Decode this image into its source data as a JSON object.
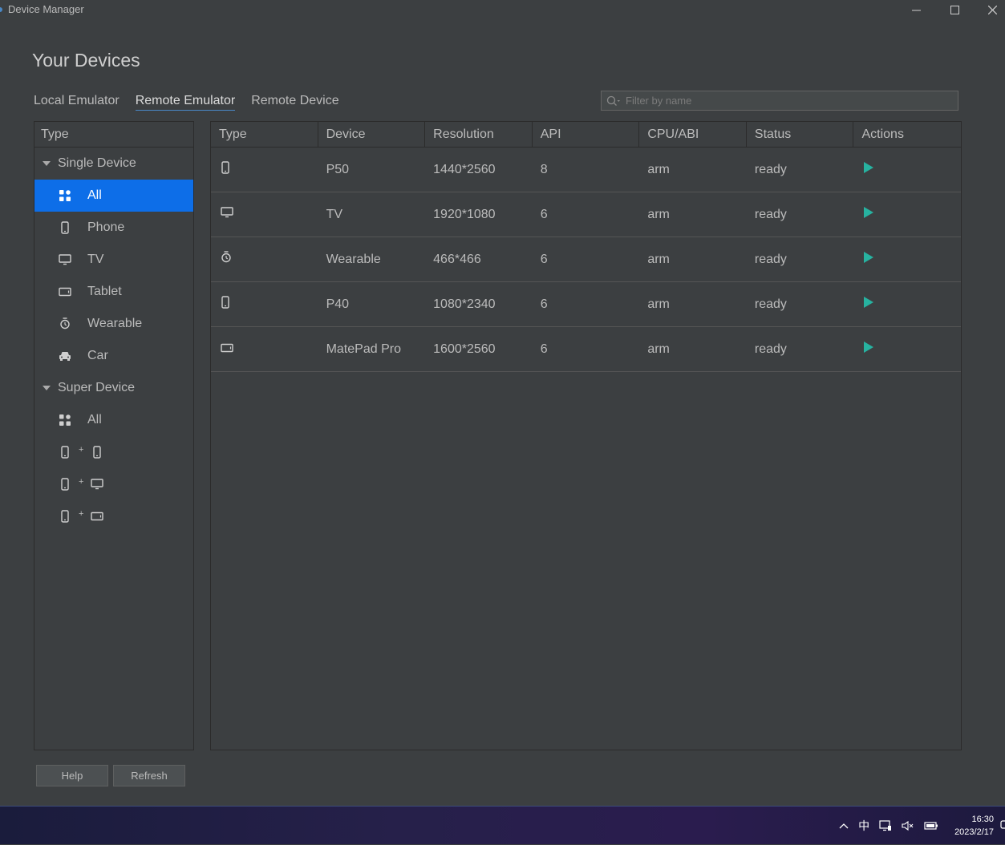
{
  "window": {
    "title": "Device Manager"
  },
  "page_title": "Your Devices",
  "tabs": [
    {
      "label": "Local Emulator",
      "active": false
    },
    {
      "label": "Remote Emulator",
      "active": true
    },
    {
      "label": "Remote Device",
      "active": false
    }
  ],
  "search": {
    "placeholder": "Filter by name",
    "value": ""
  },
  "sidebar": {
    "header": "Type",
    "groups": [
      {
        "label": "Single Device",
        "items": [
          {
            "label": "All",
            "icon": "grid-icon",
            "selected": true
          },
          {
            "label": "Phone",
            "icon": "phone-icon",
            "selected": false
          },
          {
            "label": "TV",
            "icon": "tv-icon",
            "selected": false
          },
          {
            "label": "Tablet",
            "icon": "tablet-icon",
            "selected": false
          },
          {
            "label": "Wearable",
            "icon": "watch-icon",
            "selected": false
          },
          {
            "label": "Car",
            "icon": "car-icon",
            "selected": false
          }
        ]
      },
      {
        "label": "Super Device",
        "items": [
          {
            "label": "All",
            "icon": "grid-icon"
          },
          {
            "combo": [
              "phone-icon",
              "phone-icon"
            ],
            "plus": "+"
          },
          {
            "combo": [
              "phone-icon",
              "tv-icon"
            ],
            "plus": "+"
          },
          {
            "combo": [
              "phone-icon",
              "tablet-icon"
            ],
            "plus": "+"
          }
        ]
      }
    ]
  },
  "table": {
    "columns": [
      "Type",
      "Device",
      "Resolution",
      "API",
      "CPU/ABI",
      "Status",
      "Actions"
    ],
    "rows": [
      {
        "type_icon": "phone-icon",
        "device": "P50",
        "resolution": "1440*2560",
        "api": "8",
        "cpu": "arm",
        "status": "ready",
        "action": "play-icon"
      },
      {
        "type_icon": "tv-icon",
        "device": "TV",
        "resolution": "1920*1080",
        "api": "6",
        "cpu": "arm",
        "status": "ready",
        "action": "play-icon"
      },
      {
        "type_icon": "watch-icon",
        "device": "Wearable",
        "resolution": "466*466",
        "api": "6",
        "cpu": "arm",
        "status": "ready",
        "action": "play-icon"
      },
      {
        "type_icon": "phone-icon",
        "device": "P40",
        "resolution": "1080*2340",
        "api": "6",
        "cpu": "arm",
        "status": "ready",
        "action": "play-icon"
      },
      {
        "type_icon": "tablet-icon",
        "device": "MatePad Pro",
        "resolution": "1600*2560",
        "api": "6",
        "cpu": "arm",
        "status": "ready",
        "action": "play-icon"
      }
    ]
  },
  "buttons": {
    "help": "Help",
    "refresh": "Refresh"
  },
  "colors": {
    "accent": "#0d6ee8",
    "play": "#27b2a0",
    "background": "#3c3f41"
  },
  "taskbar": {
    "ime": "中",
    "time": "16:30",
    "date": "2023/2/17"
  }
}
